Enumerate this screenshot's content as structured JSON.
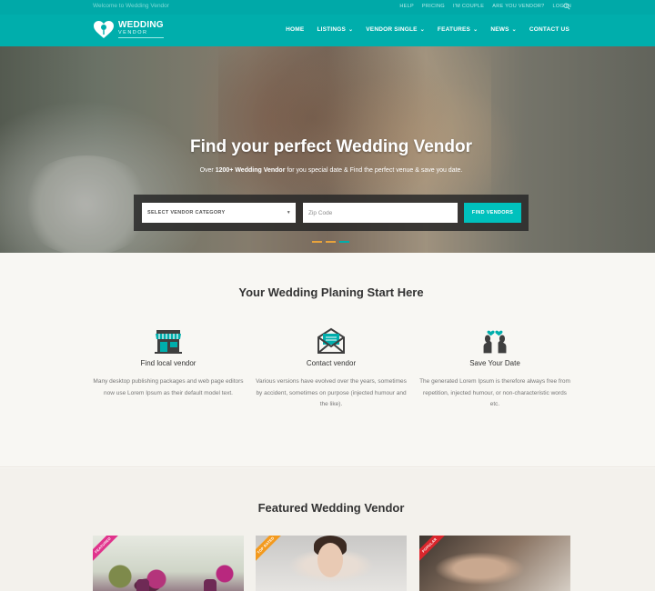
{
  "topbar": {
    "welcome": "Welcome to Wedding Vendor",
    "links": [
      "HELP",
      "PRICING",
      "I'M COUPLE",
      "ARE YOU VENDOR?",
      "LOG IN"
    ]
  },
  "logo": {
    "main": "WEDDING",
    "sub": "VENDOR"
  },
  "nav": {
    "items": [
      {
        "label": "HOME"
      },
      {
        "label": "LISTINGS"
      },
      {
        "label": "VENDOR SINGLE"
      },
      {
        "label": "FEATURES"
      },
      {
        "label": "NEWS"
      },
      {
        "label": "CONTACT US"
      }
    ]
  },
  "hero": {
    "title": "Find your perfect Wedding Vendor",
    "sub_prefix": "Over",
    "sub_bold": "1200+ Wedding Vendor",
    "sub_rest": "for you special date & Find the perfect venue & save you date.",
    "select_label": "SELECT VENDOR CATEGORY",
    "zip_placeholder": "Zip Code",
    "find_button": "FIND VENDORS",
    "slide_dots": 3,
    "active_dot_color": "#00aeac",
    "dot_color": "#e8a33c"
  },
  "planning": {
    "title": "Your Wedding Planing Start Here",
    "features": [
      {
        "icon": "store-icon",
        "title": "Find local vendor",
        "text": "Many desktop publishing packages and web page editors now use Lorem Ipsum as their default model text."
      },
      {
        "icon": "envelope-icon",
        "title": "Contact vendor",
        "text": "Various versions have evolved over the years, sometimes by accident, sometimes on purpose (injected humour and the like)."
      },
      {
        "icon": "couple-icon",
        "title": "Save Your Date",
        "text": "The generated Lorem Ipsum is therefore always free from repetition, injected humour, or non-characteristic words etc."
      }
    ]
  },
  "featured": {
    "title": "Featured Wedding Vendor",
    "cards": [
      {
        "ribbon": "FEATURED",
        "ribbon_color": "#e0338c"
      },
      {
        "ribbon": "TOP RATED",
        "ribbon_color": "#f39a1e"
      },
      {
        "ribbon": "POPULAR",
        "ribbon_color": "#d9262c"
      }
    ]
  },
  "colors": {
    "brand": "#00aeac",
    "accent": "#00c1bd"
  }
}
